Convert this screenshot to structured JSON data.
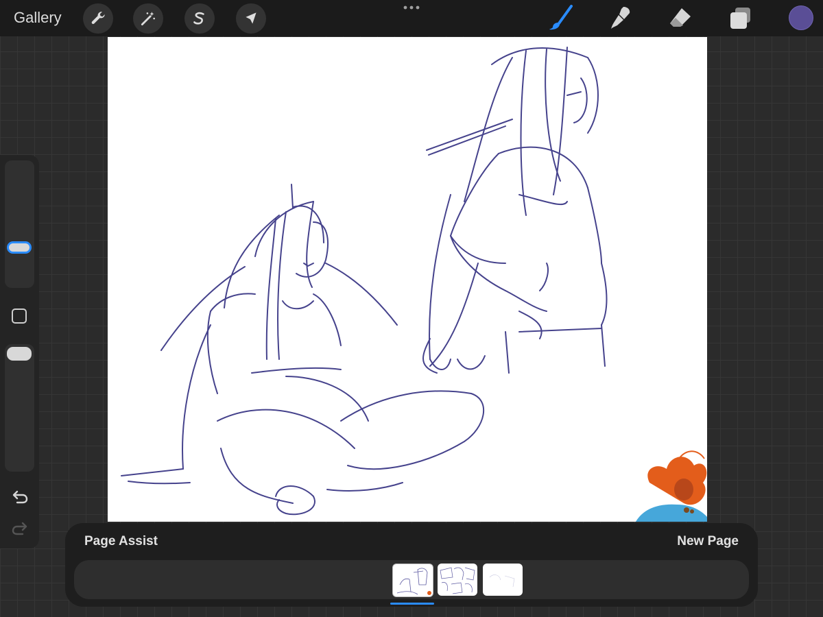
{
  "topbar": {
    "gallery_label": "Gallery",
    "left_tools": [
      "wrench-icon",
      "magic-wand-icon",
      "selection-icon",
      "transform-arrow-icon"
    ],
    "right_tools": [
      "brush-icon",
      "smudge-icon",
      "eraser-icon",
      "layers-icon"
    ],
    "active_tool": "brush-icon",
    "accent_color": "#2a8cff",
    "current_color": "#5a4e96"
  },
  "sidebar": {
    "controls": [
      "brush-size-slider",
      "modify-button",
      "opacity-slider",
      "undo-icon",
      "redo-icon"
    ]
  },
  "page_assist": {
    "title": "Page Assist",
    "new_page_label": "New Page",
    "pages": [
      "page-1",
      "page-2",
      "page-3"
    ],
    "selected_page": 1
  }
}
